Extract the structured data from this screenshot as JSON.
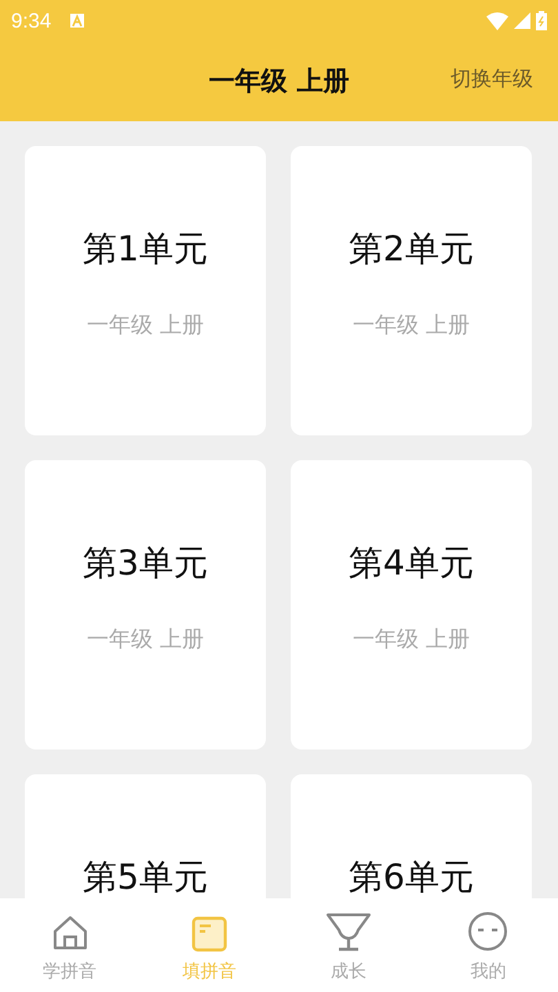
{
  "status_bar": {
    "time": "9:34"
  },
  "header": {
    "title": "一年级 上册",
    "action": "切换年级"
  },
  "units": [
    {
      "title": "第1单元",
      "subtitle": "一年级 上册"
    },
    {
      "title": "第2单元",
      "subtitle": "一年级 上册"
    },
    {
      "title": "第3单元",
      "subtitle": "一年级 上册"
    },
    {
      "title": "第4单元",
      "subtitle": "一年级 上册"
    },
    {
      "title": "第5单元"
    },
    {
      "title": "第6单元"
    }
  ],
  "tabs": [
    {
      "label": "学拼音",
      "kind": "home",
      "selected": false
    },
    {
      "label": "填拼音",
      "kind": "book",
      "selected": true
    },
    {
      "label": "成长",
      "kind": "trophy",
      "selected": false
    },
    {
      "label": "我的",
      "kind": "face",
      "selected": false
    }
  ]
}
